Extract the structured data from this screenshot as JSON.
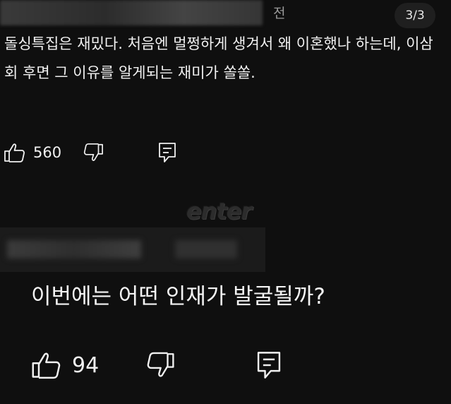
{
  "header": {
    "time_suffix": "전",
    "page_indicator": "3/3"
  },
  "comments": [
    {
      "text": "돌싱특집은 재밌다. 처음엔 멀쩡하게 생겨서 왜 이혼했나 하는데, 이삼회 후면 그 이유를 알게되는 재미가 쏠쏠.",
      "like_count": "560",
      "icons": [
        "thumbs-up-icon",
        "thumbs-down-icon",
        "reply-icon"
      ]
    },
    {
      "text": "이번에는 어떤 인재가 발굴될까?",
      "like_count": "94",
      "icons": [
        "thumbs-up-icon",
        "thumbs-down-icon",
        "reply-icon"
      ]
    }
  ],
  "watermark": "enter",
  "colors": {
    "background": "#0f0f0f",
    "text": "#f1f1f1",
    "muted": "#9a9a9a"
  }
}
